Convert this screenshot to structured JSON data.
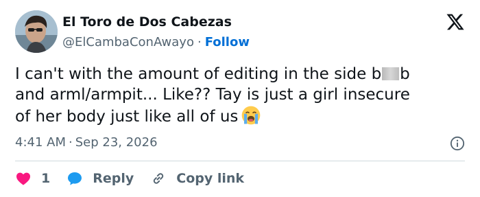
{
  "author": {
    "display_name": "El Toro de Dos Cabezas",
    "handle": "@ElCambaConAwayo",
    "follow_label": "Follow"
  },
  "tweet": {
    "line1_before": "I can't with the amount of editing in the side b",
    "line1_after": "b",
    "line2": "and arml/armpit... Like?? Tay is just a girl insecure",
    "line3": "of her body just like all of us",
    "emoji": "loudly-crying-face"
  },
  "meta": {
    "time": "4:41 AM",
    "separator": "·",
    "date": "Sep 23, 2026"
  },
  "actions": {
    "like_count": "1",
    "reply_label": "Reply",
    "copy_link_label": "Copy link"
  },
  "colors": {
    "like": "#f91880",
    "reply": "#1d9bf0",
    "link": "#006fd6",
    "secondary_text": "#536471"
  }
}
